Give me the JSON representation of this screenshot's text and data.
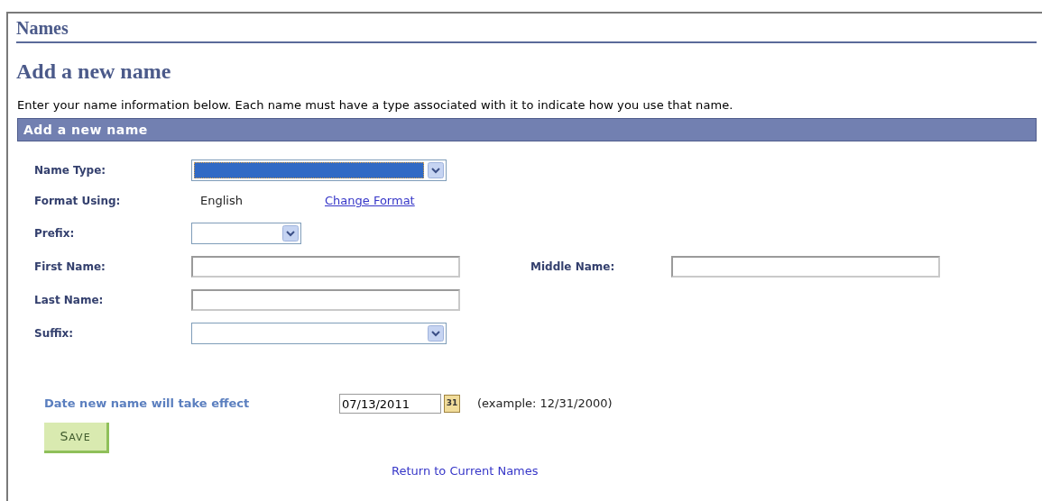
{
  "page_title": "Names",
  "heading": "Add a new name",
  "description": "Enter your name information below. Each name must have a type associated with it to indicate how you use that name.",
  "section_header": "Add a new name",
  "rows": [
    [
      {
        "label": "Name Type:",
        "kind": "select",
        "highlighted": true
      }
    ],
    [
      {
        "label": "Format Using:",
        "kind": "value",
        "value": "English",
        "link": "Change Format"
      }
    ],
    [
      {
        "label": "Prefix:",
        "kind": "short_select",
        "highlighted": false
      }
    ],
    [
      {
        "label": "First Name:",
        "kind": "text"
      },
      {
        "label": "Middle Name:",
        "kind": "text"
      }
    ],
    [
      {
        "label": "Last Name:",
        "kind": "text"
      }
    ],
    [
      {
        "label": "Suffix:",
        "kind": "select",
        "highlighted": false
      }
    ]
  ],
  "effective_date": {
    "label": "Date new name will take effect",
    "value": "07/13/2011",
    "calendar_day": "31",
    "example": "(example: 12/31/2000)"
  },
  "save_button": "SAVE",
  "return_link": "Return to Current Names"
}
